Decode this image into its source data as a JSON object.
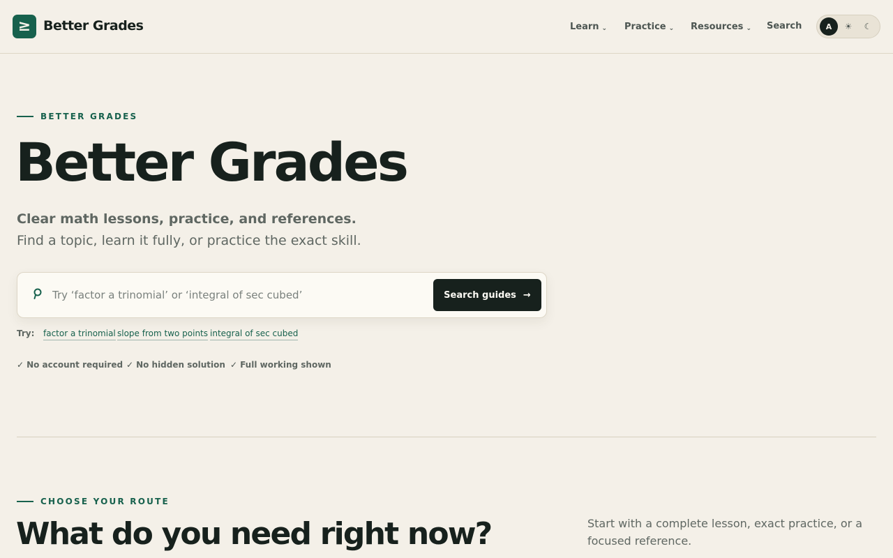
{
  "brand": {
    "name": "Better Grades",
    "logo_glyph": "≥",
    "accent": "#17614d"
  },
  "nav": {
    "items": [
      {
        "label": "Learn",
        "has_menu": true
      },
      {
        "label": "Practice",
        "has_menu": true
      },
      {
        "label": "Resources",
        "has_menu": true
      },
      {
        "label": "Search",
        "has_menu": false
      }
    ],
    "chevron": "⌄"
  },
  "theme_toggle": {
    "options": [
      {
        "label": "A",
        "icon": "auto-icon",
        "active": true
      },
      {
        "label": "☀",
        "icon": "sun-icon",
        "active": false
      },
      {
        "label": "☾",
        "icon": "moon-icon",
        "active": false
      }
    ]
  },
  "hero": {
    "eyebrow": "BETTER GRADES",
    "title": "Better Grades",
    "lead_strong": "Clear math lessons, practice, and references.",
    "lead": "Find a topic, learn it fully, or practice the exact skill.",
    "search": {
      "placeholder": "Try ‘factor a trinomial’ or ‘integral of sec cubed’",
      "value": "",
      "button_label": "Search guides",
      "button_arrow": "→"
    },
    "try": {
      "label": "Try:",
      "links": [
        "factor a trinomial",
        "slope from two points",
        "integral of sec cubed"
      ]
    },
    "checks": {
      "tick": "✓",
      "items": [
        "No account required",
        "No hidden solution",
        "Full working shown"
      ]
    }
  },
  "routes": {
    "eyebrow": "CHOOSE YOUR ROUTE",
    "title": "What do you need right now?",
    "description": "Start with a complete lesson, exact practice, or a focused reference."
  }
}
